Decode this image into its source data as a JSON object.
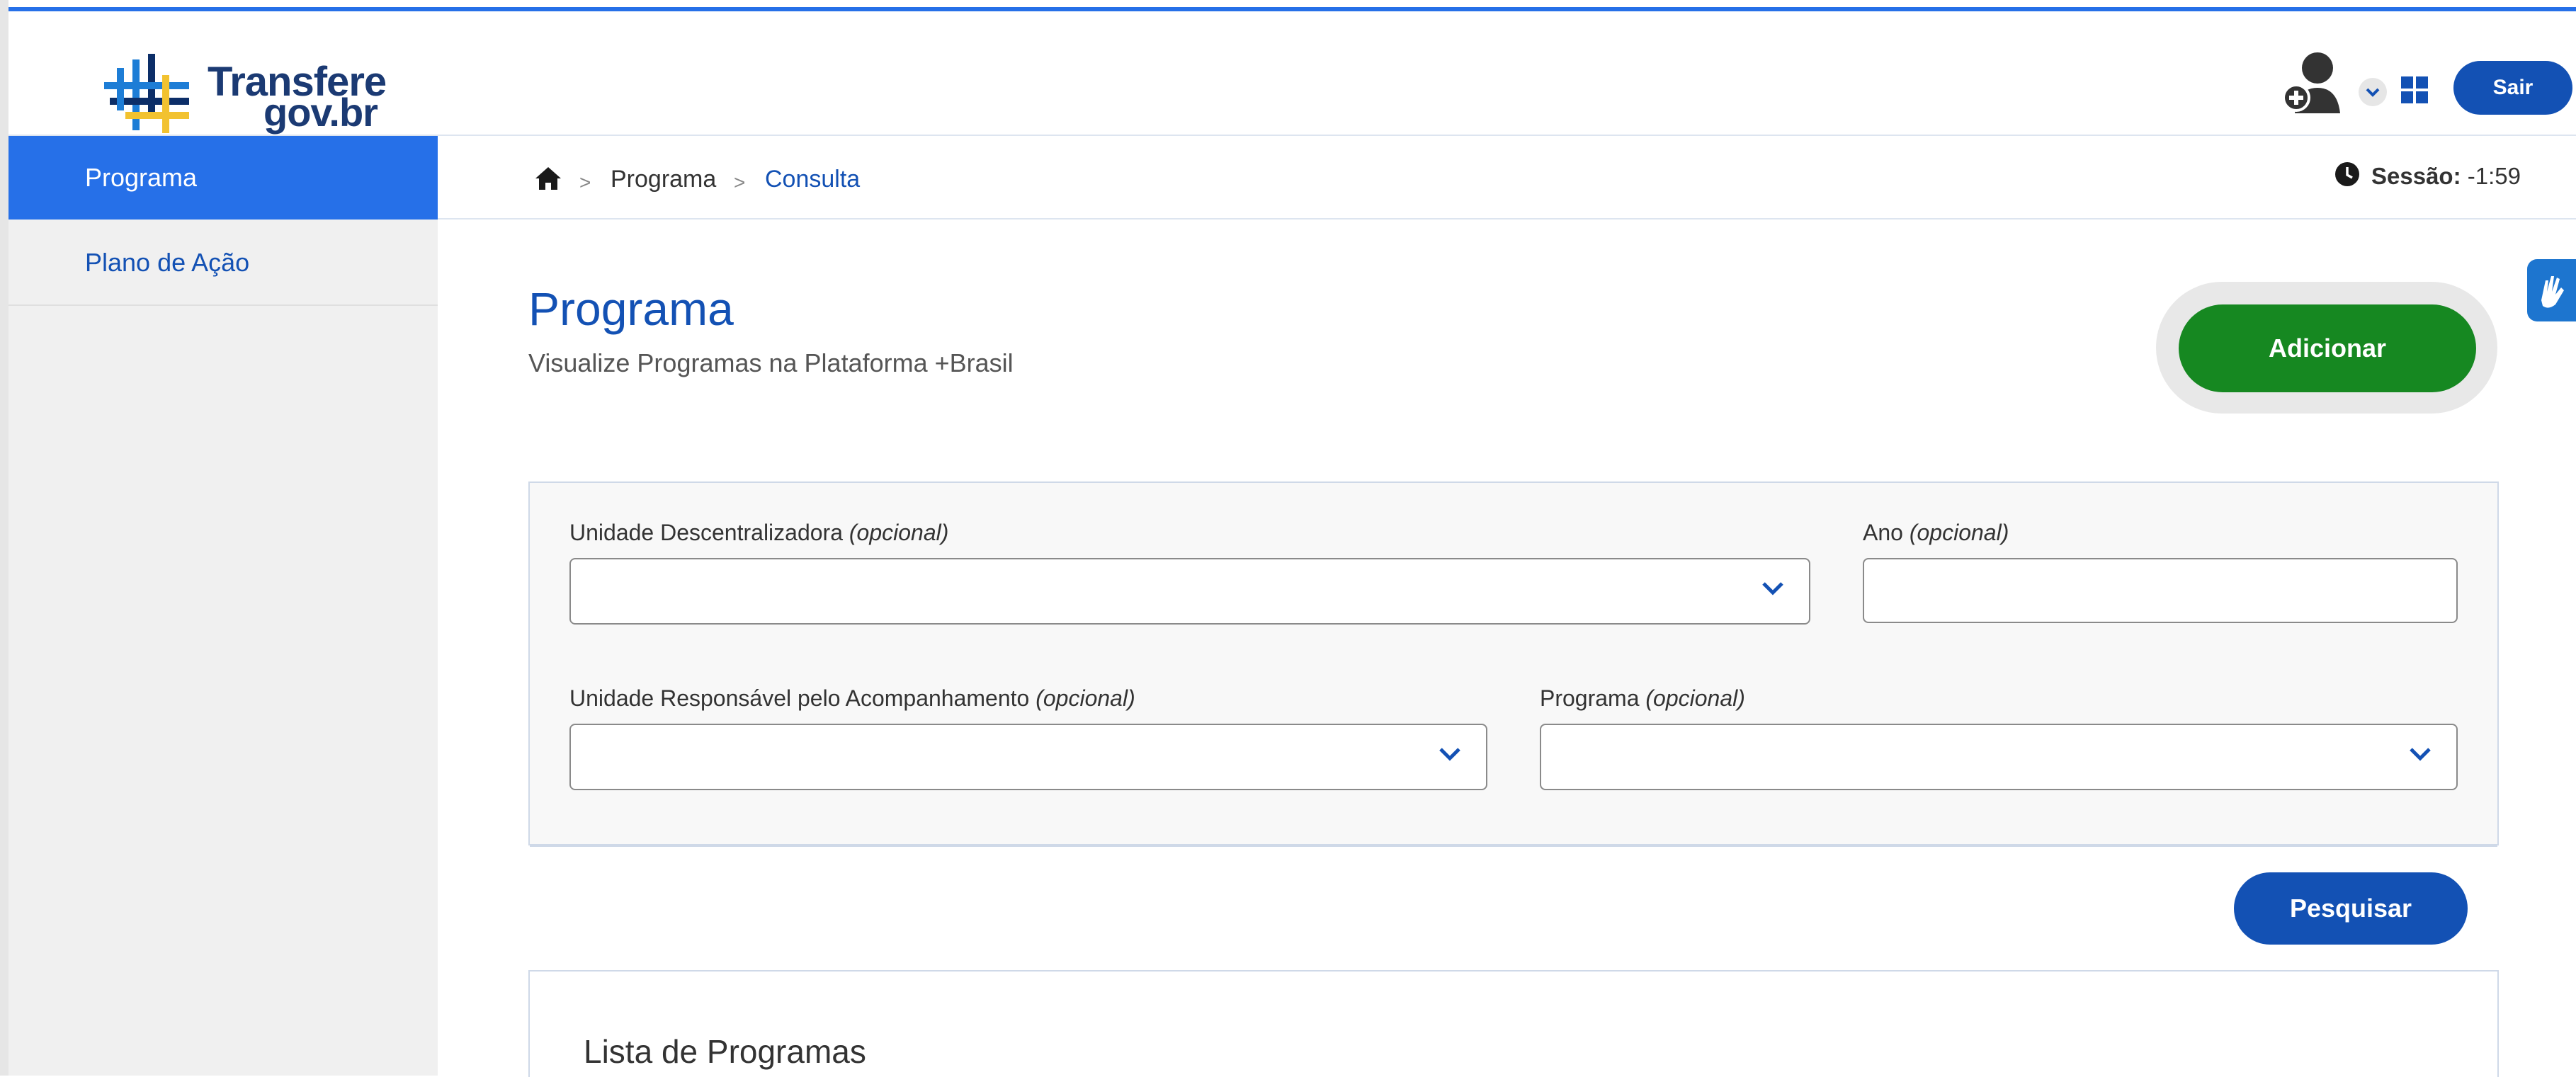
{
  "logo": {
    "line1": "Transfere",
    "line2": "gov.br"
  },
  "header": {
    "logout_label": "Sair",
    "user_icon": "user-add-icon",
    "apps_icon": "grid-icon"
  },
  "sidebar": {
    "items": [
      {
        "label": "Programa",
        "active": true
      },
      {
        "label": "Plano de Ação",
        "active": false
      }
    ]
  },
  "breadcrumb": {
    "home_icon": "home-icon",
    "separator": ">",
    "items": [
      "Programa",
      "Consulta"
    ]
  },
  "session": {
    "label": "Sessão:",
    "value": "-1:59"
  },
  "page": {
    "title": "Programa",
    "subtitle": "Visualize Programas na Plataforma +Brasil",
    "add_label": "Adicionar"
  },
  "filters": {
    "unidade_descentralizadora": {
      "label": "Unidade Descentralizadora",
      "hint": "(opcional)",
      "value": ""
    },
    "ano": {
      "label": "Ano",
      "hint": "(opcional)",
      "value": ""
    },
    "unidade_responsavel": {
      "label": "Unidade Responsável pelo Acompanhamento",
      "hint": "(opcional)",
      "value": ""
    },
    "programa": {
      "label": "Programa",
      "hint": "(opcional)",
      "value": ""
    },
    "search_label": "Pesquisar"
  },
  "list": {
    "title": "Lista de Programas"
  },
  "colors": {
    "primary": "#1351b4",
    "active_nav": "#2670e8",
    "success": "#168821"
  }
}
